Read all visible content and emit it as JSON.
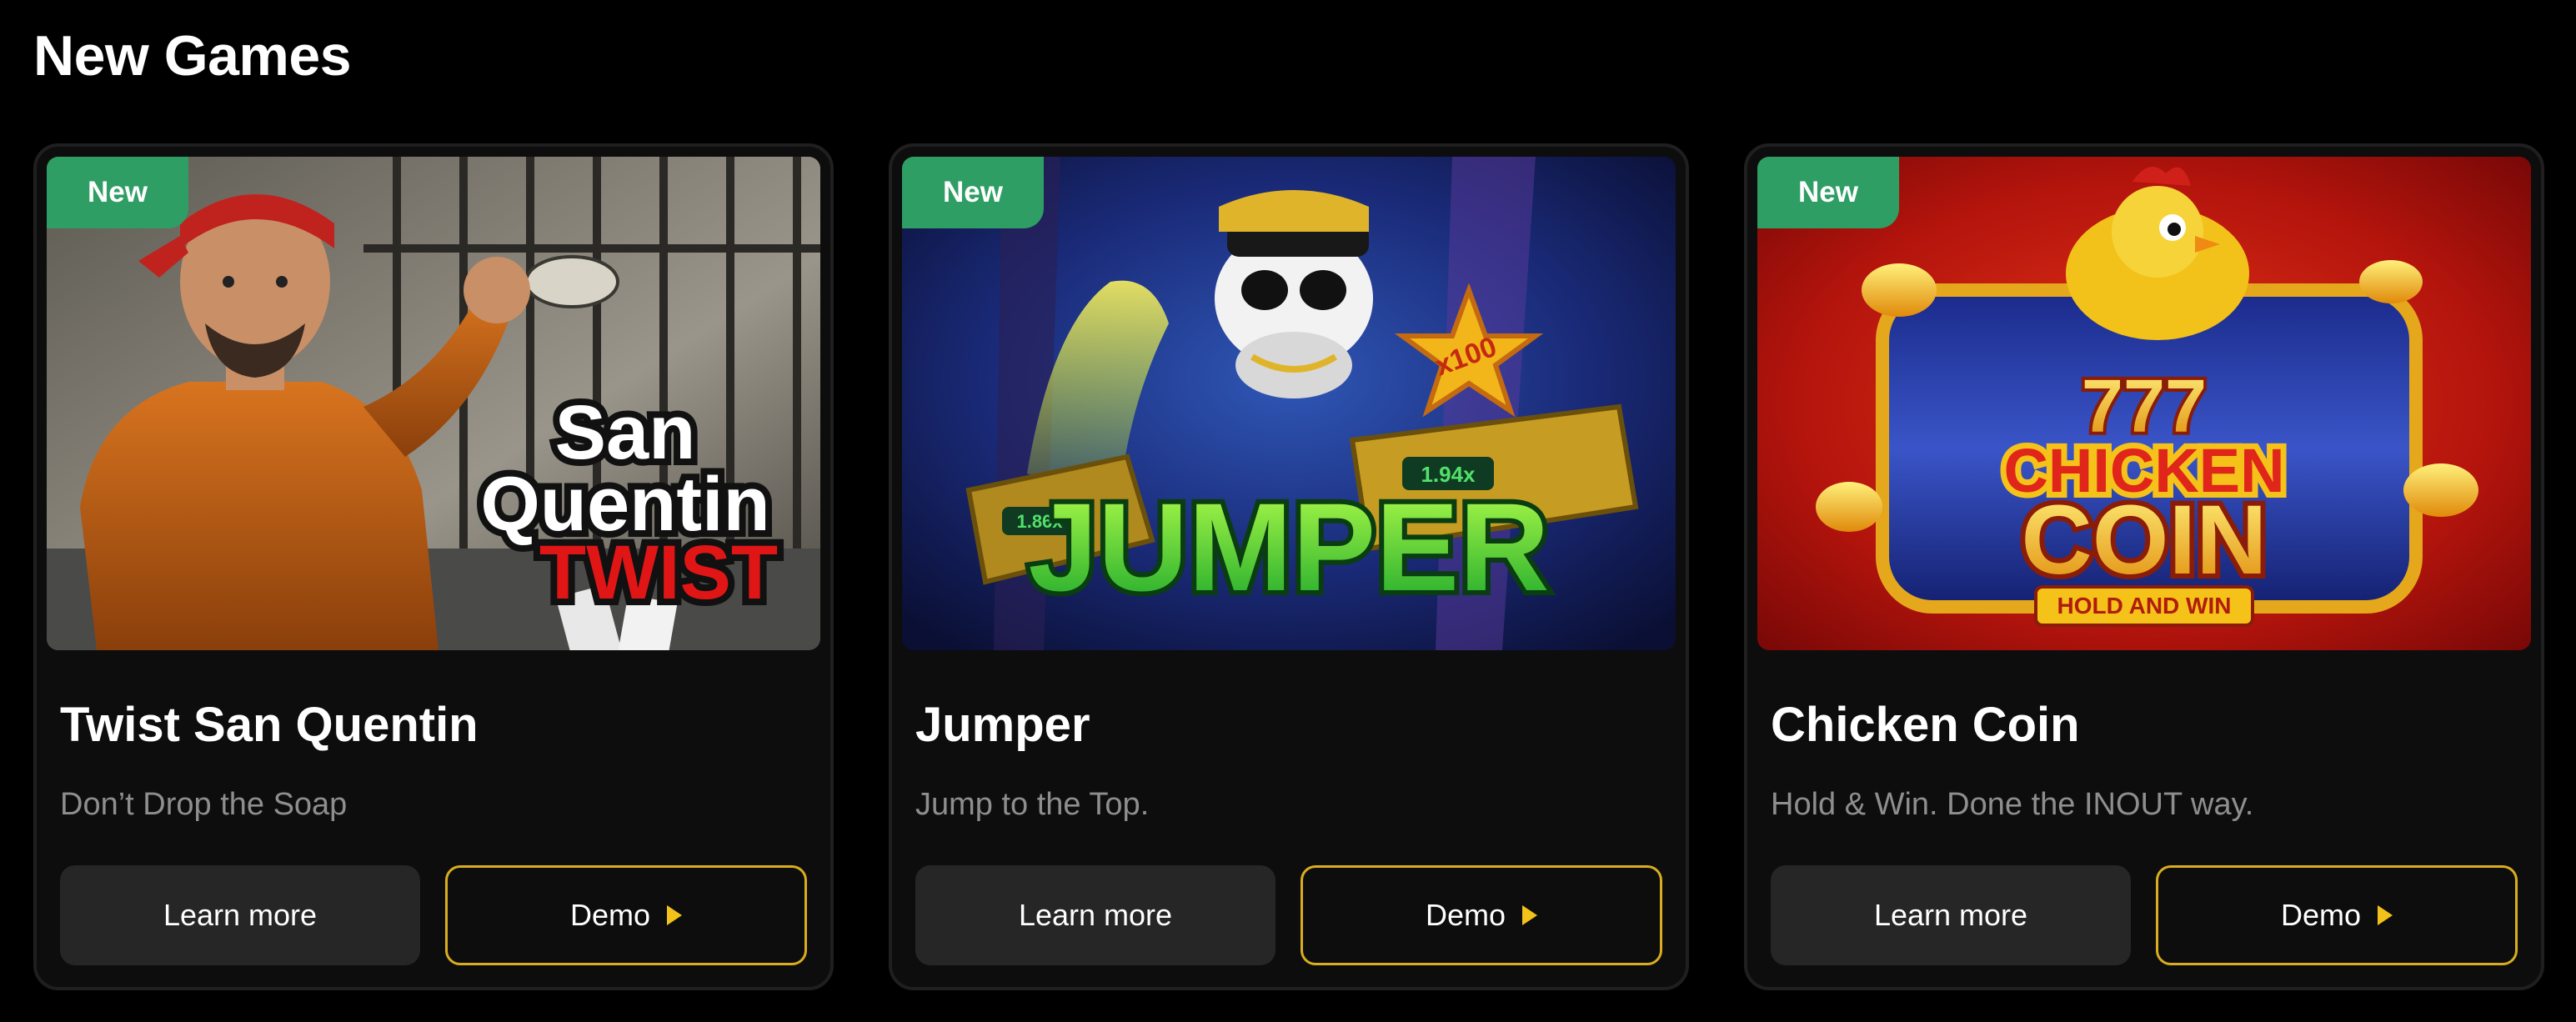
{
  "section": {
    "title": "New Games"
  },
  "colors": {
    "badge": "#2e9e64",
    "demo_border": "#d9ad1f",
    "play_icon": "#f2c21a",
    "card_bg": "#0d0d0d"
  },
  "cards": [
    {
      "badge": "New",
      "title": "Twist San Quentin",
      "subtitle": "Don’t Drop the Soap",
      "learn_more": "Learn more",
      "demo": "Demo",
      "art": {
        "line1": "San",
        "line2": "Quentin",
        "line3": "TWIST"
      }
    },
    {
      "badge": "New",
      "title": "Jumper",
      "subtitle": "Jump to the Top.",
      "learn_more": "Learn more",
      "demo": "Demo",
      "art": {
        "logo": "JUMPER",
        "star_mult": "x100",
        "mult_a": "1.94x",
        "mult_b": "1.86x"
      }
    },
    {
      "badge": "New",
      "title": "Chicken Coin",
      "subtitle": "Hold & Win. Done the INOUT way.",
      "learn_more": "Learn more",
      "demo": "Demo",
      "art": {
        "sevens": "777",
        "line1": "CHICKEN",
        "line2": "COIN",
        "tag": "HOLD AND WIN"
      }
    }
  ]
}
